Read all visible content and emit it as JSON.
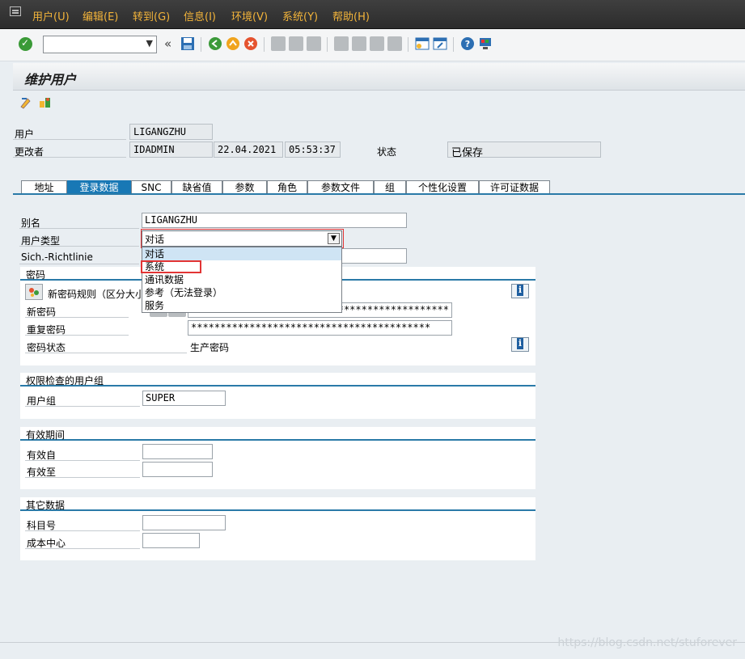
{
  "menu": [
    "用户(U)",
    "编辑(E)",
    "转到(G)",
    "信息(I)",
    "环境(V)",
    "系统(Y)",
    "帮助(H)"
  ],
  "toolbar": {
    "command_value": "",
    "back_symbol": "«"
  },
  "title": "维护用户",
  "header": {
    "user_label": "用户",
    "user_value": "LIGANGZHU",
    "changed_by_label": "更改者",
    "changed_by_value": "IDADMIN",
    "date": "22.04.2021",
    "time": "05:53:37",
    "status_label": "状态",
    "status_value": "已保存"
  },
  "tabs": [
    "地址",
    "登录数据",
    "SNC",
    "缺省值",
    "参数",
    "角色",
    "参数文件",
    "组",
    "个性化设置",
    "许可证数据"
  ],
  "active_tab": "登录数据",
  "logon": {
    "alias_label": "别名",
    "alias_value": "LIGANGZHU",
    "user_type_label": "用户类型",
    "user_type_value": "对话",
    "security_policy_label": "Sich.-Richtlinie",
    "dropdown_options": [
      "对话",
      "系统",
      "通讯数据",
      "参考（无法登录）",
      "服务"
    ],
    "dropdown_selected": "对话",
    "dropdown_highlighted": "系统"
  },
  "password": {
    "section_title": "密码",
    "rules_button": "新密码规则（区分大小",
    "new_label": "新密码",
    "new_value": "*****************************",
    "repeat_label": "重复密码",
    "repeat_value": "*****************************************",
    "status_label": "密码状态",
    "status_value": "生产密码"
  },
  "auth_group": {
    "section_title": "权限检查的用户组",
    "label": "用户组",
    "value": "SUPER"
  },
  "validity": {
    "section_title": "有效期间",
    "from_label": "有效自",
    "to_label": "有效至",
    "from_value": "",
    "to_value": ""
  },
  "other": {
    "section_title": "其它数据",
    "account_label": "科目号",
    "cost_center_label": "成本中心",
    "account_value": "",
    "cost_center_value": ""
  },
  "watermark": "https://blog.csdn.net/stuforever"
}
